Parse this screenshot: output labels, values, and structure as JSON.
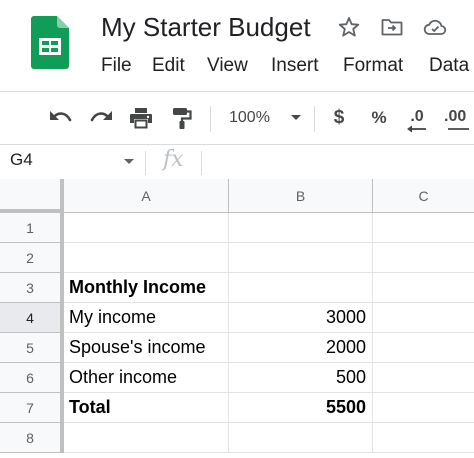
{
  "document": {
    "title": "My Starter Budget"
  },
  "menu": [
    "File",
    "Edit",
    "View",
    "Insert",
    "Format",
    "Data"
  ],
  "toolbar": {
    "zoom": "100%",
    "currency": "$",
    "percent": "%",
    "decrease_decimals": ".0",
    "increase_decimals": ".00"
  },
  "formula_bar": {
    "name_box": "G4",
    "fx": "fx",
    "value": ""
  },
  "columns": [
    "A",
    "B",
    "C"
  ],
  "rows": [
    {
      "num": "1",
      "a": "",
      "b": "",
      "bold": false
    },
    {
      "num": "2",
      "a": "",
      "b": "",
      "bold": false
    },
    {
      "num": "3",
      "a": "Monthly Income",
      "b": "",
      "bold": true
    },
    {
      "num": "4",
      "a": "My income",
      "b": "3000",
      "bold": false
    },
    {
      "num": "5",
      "a": "Spouse's income",
      "b": "2000",
      "bold": false
    },
    {
      "num": "6",
      "a": "Other income",
      "b": "500",
      "bold": false
    },
    {
      "num": "7",
      "a": "Total",
      "b": "5500",
      "bold": true
    },
    {
      "num": "8",
      "a": "",
      "b": "",
      "bold": false
    }
  ],
  "active_row": "4",
  "colors": {
    "sheets_green": "#0F9D58",
    "header_bg": "#f8f9fa",
    "gridline": "#e2e3e3"
  }
}
